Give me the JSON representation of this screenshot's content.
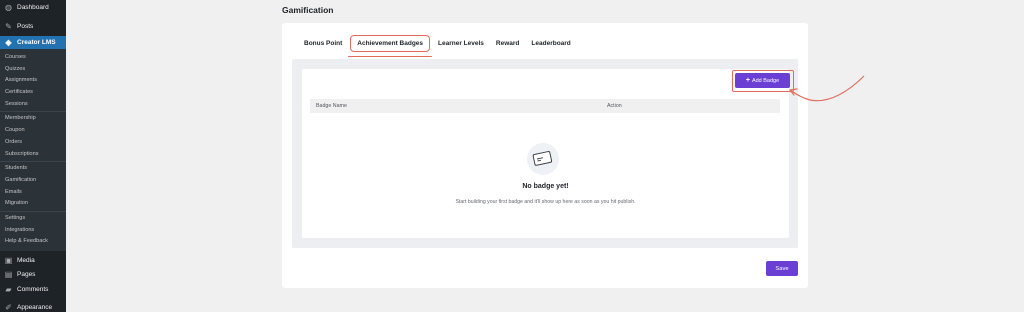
{
  "sidebar": {
    "top_items": [
      {
        "label": "Dashboard",
        "icon": "dashboard-icon"
      },
      {
        "label": "Posts",
        "icon": "pin-icon"
      }
    ],
    "active": {
      "label": "Creator LMS",
      "icon": "creator-lms-icon"
    },
    "submenu_groups": [
      [
        "Courses",
        "Quizzes",
        "Assignments",
        "Certificates",
        "Sessions"
      ],
      [
        "Membership",
        "Coupon",
        "Orders",
        "Subscriptions"
      ],
      [
        "Students",
        "Gamification",
        "Emails",
        "Migration"
      ],
      [
        "Settings",
        "Integrations",
        "Help & Feedback"
      ]
    ],
    "bottom_items": [
      {
        "label": "Media",
        "icon": "media-icon"
      },
      {
        "label": "Pages",
        "icon": "pages-icon"
      },
      {
        "label": "Comments",
        "icon": "comments-icon"
      },
      {
        "label": "Appearance",
        "icon": "appearance-icon"
      }
    ]
  },
  "page": {
    "title": "Gamification"
  },
  "tabs": [
    "Bonus Point",
    "Achievement Badges",
    "Learner Levels",
    "Reward",
    "Leaderboard"
  ],
  "active_tab": "Achievement Badges",
  "actions": {
    "add_badge": "Add Badge",
    "save": "Save"
  },
  "table": {
    "columns": [
      "Badge Name",
      "Action"
    ]
  },
  "empty_state": {
    "title": "No badge yet!",
    "description": "Start building your first badge and it'll show up here as soon as you hit publish.",
    "icon": "badge-card-icon"
  },
  "colors": {
    "accent": "#6b3fd4",
    "sidebar_bg": "#1d2327",
    "sidebar_active": "#2271b1",
    "highlight": "#e26d5c"
  }
}
